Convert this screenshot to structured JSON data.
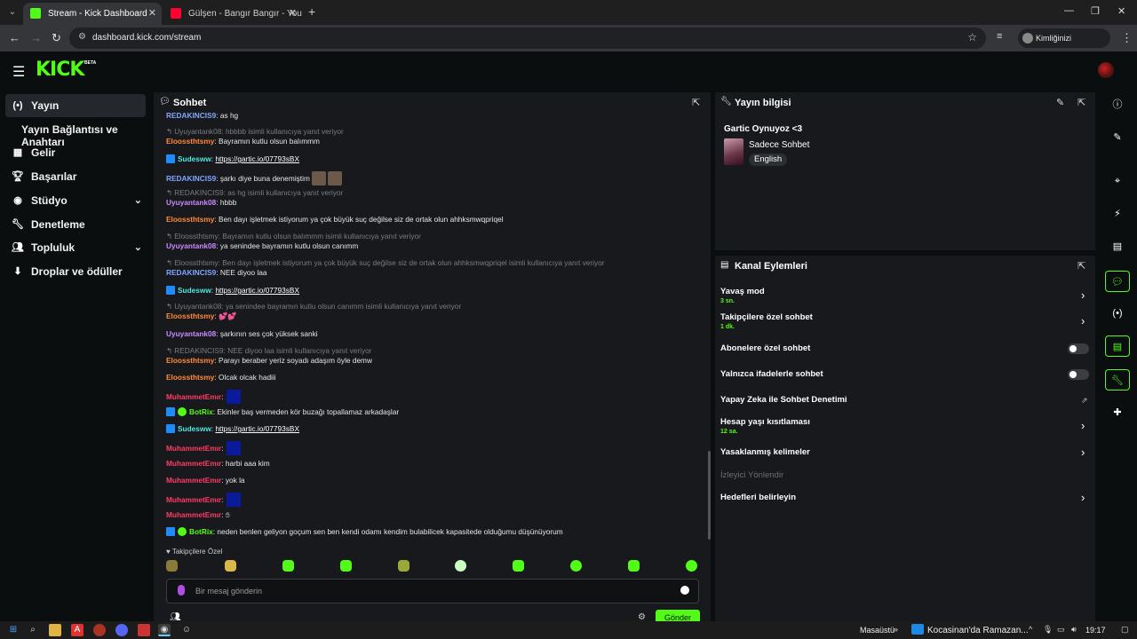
{
  "browser": {
    "tabs": [
      {
        "title": "Stream - Kick Dashboard",
        "favicon_color": "#53fc18"
      },
      {
        "title": "Gülşen - Bangır Bangır - YouTube",
        "favicon_color": "#ff0033"
      }
    ],
    "url": "dashboard.kick.com/stream",
    "profile_label": "Kimliğinizi doğrulayın"
  },
  "kick": {
    "logo": "KICK",
    "logo_badge": "BETA"
  },
  "sidebar": {
    "items": [
      {
        "label": "Yayın",
        "icon": "broadcast-icon"
      },
      {
        "label": "Yayın Bağlantısı ve Anahtarı"
      },
      {
        "label": "Gelir",
        "icon": "chart-icon"
      },
      {
        "label": "Başarılar",
        "icon": "trophy-icon"
      },
      {
        "label": "Stüdyo",
        "icon": "studio-icon"
      },
      {
        "label": "Denetleme",
        "icon": "wrench-icon"
      },
      {
        "label": "Topluluk",
        "icon": "community-icon"
      },
      {
        "label": "Droplar ve ödüller",
        "icon": "drops-icon"
      }
    ]
  },
  "chat": {
    "title": "Sohbet",
    "messages": [
      {
        "user": "REDAKINCIS9",
        "text": "as hg"
      },
      {
        "reply": "hbbbb isimli kullanıcıya yanıt veriyor",
        "reply_user": "Uyuyantank08"
      },
      {
        "user": "Eloossthtsmy",
        "text": "Bayramın kutlu olsun balımmm"
      },
      {
        "user": "Sudesww",
        "text": "https://gartic.io/07793sBX"
      },
      {
        "user": "REDAKINCIS9",
        "text": "şarkı diye buna denemiştim"
      },
      {
        "reply": "as hg isimli kullanıcıya yanıt veriyor",
        "reply_user": "REDAKINCIS9"
      },
      {
        "user": "Uyuyantank08",
        "text": "hbbb"
      },
      {
        "user": "Eloossthtsmy",
        "text": "Ben dayı işletmek istiyorum ya çok büyük suç değilse siz de ortak olun ahhksmwqpriqel"
      },
      {
        "reply": "Bayramın kutlu olsun balımmm isimli kullanıcıya yanıt veriyor",
        "reply_user": "Eloossthtsmy"
      },
      {
        "user": "Uyuyantank08",
        "text": "ya senindee bayramın kutlu olsun canımm"
      },
      {
        "reply": "Ben dayı işletmek istiyorum ya çok büyük suç değilse siz de ortak olun ahhksmwqpriqel isimli kullanıcıya yanıt veriyor",
        "reply_user": "Eloossthtsmy"
      },
      {
        "user": "REDAKINCIS9",
        "text": "NEE diyoo laa"
      },
      {
        "user": "Sudesww",
        "text": "https://gartic.io/07793sBX"
      },
      {
        "reply": "ya senindee bayramın kutlu olsun canımm isimli kullanıcıya yanıt veriyor",
        "reply_user": "Uyuyantank08"
      },
      {
        "user": "Eloossthtsmy",
        "text": "💕💕"
      },
      {
        "user": "Uyuyantank08",
        "text": "şarkının ses çok yüksek sanki"
      },
      {
        "reply": "NEE diyoo laa isimli kullanıcıya yanıt veriyor",
        "reply_user": "REDAKINCIS9"
      },
      {
        "user": "Eloossthtsmy",
        "text": "Parayı beraber yeriz soyadı adaşım öyle demw"
      },
      {
        "user": "Eloossthtsmy",
        "text": "Olcak olcak hadiii"
      },
      {
        "user": "MuhammetEmır",
        "text": ""
      },
      {
        "user": "BotRix",
        "text": "Ekinler baş vermeden kör buzağı topallamaz arkadaşlar"
      },
      {
        "user": "Sudesww",
        "text": "https://gartic.io/07793sBX"
      },
      {
        "user": "MuhammetEmır",
        "text": ""
      },
      {
        "user": "MuhammetEmır",
        "text": "harbi aaa kim"
      },
      {
        "user": "MuhammetEmır",
        "text": "yok la"
      },
      {
        "user": "MuhammetEmır",
        "text": ""
      },
      {
        "user": "MuhammetEmır",
        "text": ""
      },
      {
        "user": "BotRix",
        "text": "neden benlen geliyon goçum sen ben kendi odamı kendim bulabilicek kapasitede olduğumu düşünüyorum"
      }
    ],
    "followers_only": "Takipçilere Özel",
    "input_placeholder": "Bir mesaj gönderin",
    "send_label": "Gönder"
  },
  "stream_info": {
    "title": "Yayın bilgisi",
    "stream_title": "Gartic Oynuyoz <3",
    "category": "Sadece Sohbet",
    "language": "English"
  },
  "actions": {
    "title": "Kanal Eylemleri",
    "slow_mode": {
      "label": "Yavaş mod",
      "value": "3 sn."
    },
    "followers_chat": {
      "label": "Takipçilere özel sohbet",
      "value": "1 dk."
    },
    "subs_chat": {
      "label": "Abonelere özel sohbet",
      "enabled": false
    },
    "emotes_chat": {
      "label": "Yalnızca ifadelerle sohbet",
      "enabled": false
    },
    "ai_moderation": {
      "label": "Yapay Zeka ile Sohbet Denetimi"
    },
    "account_age": {
      "label": "Hesap yaşı kısıtlaması",
      "value": "12 sa."
    },
    "banned_words": {
      "label": "Yasaklanmış kelimeler"
    },
    "viewer_redirect": {
      "label": "İzleyici Yönlendir"
    },
    "set_targets": {
      "label": "Hedefleri belirleyin"
    }
  },
  "taskbar": {
    "desktop_label": "Masaüstü",
    "weather_label": "Kocasinan'da Ramazan...",
    "clock": "19:17"
  },
  "colors": {
    "accent": "#53fc18",
    "panel": "#17191c",
    "background": "#0b0e0f"
  }
}
